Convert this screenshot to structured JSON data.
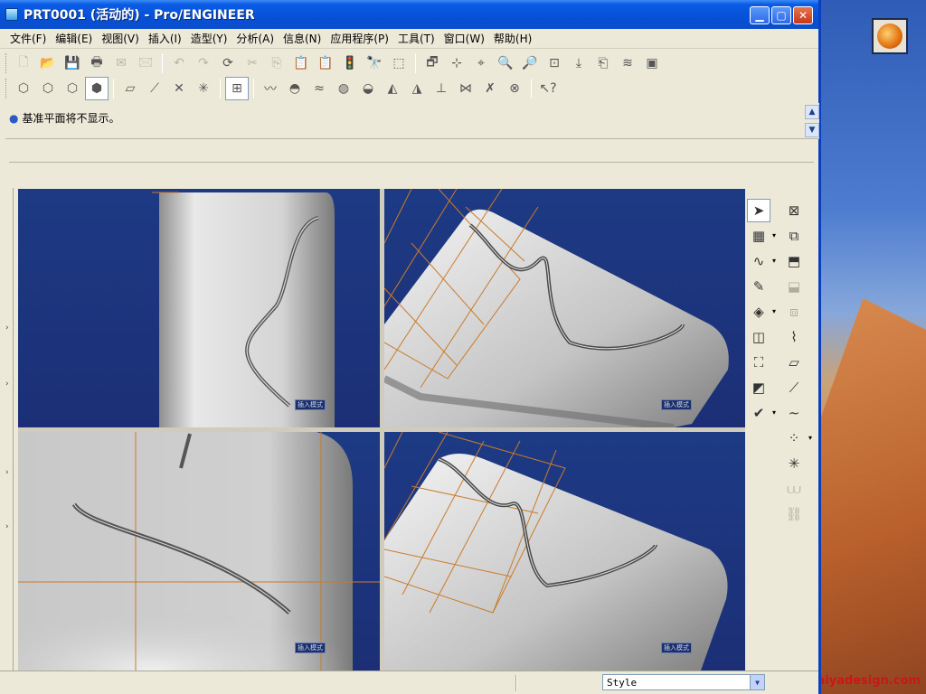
{
  "window": {
    "title": "PRT0001 (活动的) - Pro/ENGINEER",
    "controls": {
      "minimize": "▁",
      "maximize": "▢",
      "close": "✕"
    }
  },
  "menu": [
    "文件(F)",
    "编辑(E)",
    "视图(V)",
    "插入(I)",
    "造型(Y)",
    "分析(A)",
    "信息(N)",
    "应用程序(P)",
    "工具(T)",
    "窗口(W)",
    "帮助(H)"
  ],
  "toolbar1": [
    {
      "name": "new-icon",
      "glyph": "🗋",
      "state": "disabled"
    },
    {
      "name": "open-icon",
      "glyph": "📂",
      "state": "disabled"
    },
    {
      "name": "save-icon",
      "glyph": "💾",
      "state": "disabled"
    },
    {
      "name": "print-icon",
      "glyph": "🖶",
      "state": "enabled"
    },
    {
      "name": "send-mail-icon",
      "glyph": "✉",
      "state": "disabled"
    },
    {
      "name": "send-attach-icon",
      "glyph": "🖂",
      "state": "disabled"
    },
    {
      "sep": true
    },
    {
      "name": "undo-icon",
      "glyph": "↶",
      "state": "disabled"
    },
    {
      "name": "redo-icon",
      "glyph": "↷",
      "state": "disabled"
    },
    {
      "name": "regenerate-icon",
      "glyph": "⟳",
      "state": "enabled"
    },
    {
      "name": "cut-icon",
      "glyph": "✂",
      "state": "disabled"
    },
    {
      "name": "copy-icon",
      "glyph": "⎘",
      "state": "disabled"
    },
    {
      "name": "paste-icon",
      "glyph": "📋",
      "state": "disabled"
    },
    {
      "name": "paste-special-icon",
      "glyph": "📋",
      "state": "disabled"
    },
    {
      "name": "model-player-icon",
      "glyph": "🚦",
      "state": "enabled"
    },
    {
      "name": "find-icon",
      "glyph": "🔭",
      "state": "enabled"
    },
    {
      "name": "select-box-icon",
      "glyph": "⬚",
      "state": "enabled"
    },
    {
      "sep": true
    },
    {
      "name": "repaint-icon",
      "glyph": "🗗",
      "state": "enabled"
    },
    {
      "name": "spin-center-icon",
      "glyph": "⊹",
      "state": "enabled"
    },
    {
      "name": "orient-mode-icon",
      "glyph": "⌖",
      "state": "enabled"
    },
    {
      "name": "zoom-in-icon",
      "glyph": "🔍",
      "state": "enabled"
    },
    {
      "name": "zoom-out-icon",
      "glyph": "🔎",
      "state": "enabled"
    },
    {
      "name": "refit-icon",
      "glyph": "⊡",
      "state": "enabled"
    },
    {
      "name": "reorient-icon",
      "glyph": "⤓",
      "state": "enabled"
    },
    {
      "name": "saved-views-icon",
      "glyph": "⎗",
      "state": "enabled"
    },
    {
      "name": "layers-icon",
      "glyph": "≋",
      "state": "enabled"
    },
    {
      "name": "view-manager-icon",
      "glyph": "▣",
      "state": "enabled"
    }
  ],
  "toolbar2": [
    {
      "name": "wireframe-icon",
      "glyph": "⬡",
      "state": "enabled"
    },
    {
      "name": "hidden-line-icon",
      "glyph": "⬡",
      "state": "enabled"
    },
    {
      "name": "no-hidden-icon",
      "glyph": "⬡",
      "state": "enabled"
    },
    {
      "name": "shading-icon",
      "glyph": "⬢",
      "state": "on"
    },
    {
      "sep": true
    },
    {
      "name": "datum-plane-display-icon",
      "glyph": "▱",
      "state": "enabled"
    },
    {
      "name": "datum-axis-display-icon",
      "glyph": "⟋",
      "state": "enabled"
    },
    {
      "name": "datum-point-display-icon",
      "glyph": "✕",
      "state": "enabled"
    },
    {
      "name": "csys-display-icon",
      "glyph": "✳",
      "state": "enabled"
    },
    {
      "sep": true
    },
    {
      "name": "style-grid-icon",
      "glyph": "⊞",
      "state": "on"
    },
    {
      "sep": true
    },
    {
      "name": "curvature-icon",
      "glyph": "〰",
      "state": "enabled"
    },
    {
      "name": "section-icon",
      "glyph": "◓",
      "state": "enabled"
    },
    {
      "name": "offset-icon",
      "glyph": "≈",
      "state": "enabled"
    },
    {
      "name": "gaussian-icon",
      "glyph": "◍",
      "state": "enabled"
    },
    {
      "name": "slope-icon",
      "glyph": "◒",
      "state": "enabled"
    },
    {
      "name": "reflection-icon",
      "glyph": "◭",
      "state": "enabled"
    },
    {
      "name": "draft-icon",
      "glyph": "◮",
      "state": "enabled"
    },
    {
      "name": "dihedral-icon",
      "glyph": "⊥",
      "state": "enabled"
    },
    {
      "name": "curve-curvature-icon",
      "glyph": "⋈",
      "state": "enabled"
    },
    {
      "name": "delete-analysis-icon",
      "glyph": "✗",
      "state": "enabled"
    },
    {
      "name": "delete-all-icon",
      "glyph": "⊗",
      "state": "enabled"
    },
    {
      "sep": true
    },
    {
      "name": "whats-this-icon",
      "glyph": "↖?",
      "state": "enabled"
    }
  ],
  "message": "基准平面将不显示。",
  "viewport_tag": "插入模式",
  "status": {
    "filter_value": "Style"
  },
  "right_toolbar": [
    {
      "name": "select-arrow-icon",
      "glyph": "➤",
      "col": 0,
      "row": 0,
      "state": "on"
    },
    {
      "name": "set-active-plane-icon",
      "glyph": "▦",
      "col": 0,
      "row": 1,
      "state": "enabled",
      "drop": true
    },
    {
      "name": "create-curve-icon",
      "glyph": "∿",
      "col": 0,
      "row": 2,
      "state": "enabled",
      "drop": true
    },
    {
      "name": "edit-curve-icon",
      "glyph": "✎",
      "col": 0,
      "row": 3,
      "state": "enabled"
    },
    {
      "name": "boundary-surface-icon",
      "glyph": "◈",
      "col": 0,
      "row": 4,
      "state": "enabled",
      "drop": true
    },
    {
      "name": "connect-surface-icon",
      "glyph": "◫",
      "col": 0,
      "row": 5,
      "state": "enabled"
    },
    {
      "name": "trim-surface-icon",
      "glyph": "⛶",
      "col": 0,
      "row": 6,
      "state": "enabled"
    },
    {
      "name": "edit-surface-icon",
      "glyph": "◩",
      "col": 0,
      "row": 7,
      "state": "enabled"
    },
    {
      "name": "done-check-icon",
      "glyph": "✔",
      "col": 0,
      "row": 8,
      "state": "enabled",
      "drop": true
    },
    {
      "name": "cancel-x-icon",
      "glyph": "⊠",
      "col": 1,
      "row": 0,
      "state": "enabled"
    },
    {
      "name": "extrude-icon",
      "glyph": "⧉",
      "col": 1,
      "row": 1,
      "state": "enabled"
    },
    {
      "name": "shell-icon",
      "glyph": "⬒",
      "col": 1,
      "row": 2,
      "state": "enabled"
    },
    {
      "name": "draft-feature-icon",
      "glyph": "⬓",
      "col": 1,
      "row": 3,
      "state": "disabled"
    },
    {
      "name": "pattern-icon",
      "glyph": "⧈",
      "col": 1,
      "row": 4,
      "state": "disabled"
    },
    {
      "name": "sketch-icon",
      "glyph": "⌇",
      "col": 1,
      "row": 5,
      "state": "enabled"
    },
    {
      "name": "datum-plane-icon",
      "glyph": "▱",
      "col": 1,
      "row": 6,
      "state": "enabled"
    },
    {
      "name": "datum-axis-icon",
      "glyph": "⟋",
      "col": 1,
      "row": 7,
      "state": "enabled"
    },
    {
      "name": "datum-curve-icon",
      "glyph": "∼",
      "col": 1,
      "row": 8,
      "state": "enabled"
    },
    {
      "name": "datum-point-icon",
      "glyph": "⁘",
      "col": 1,
      "row": 9,
      "state": "enabled",
      "drop": true
    },
    {
      "name": "csys-icon",
      "glyph": "✳",
      "col": 1,
      "row": 10,
      "state": "enabled"
    },
    {
      "name": "analysis-feature-icon",
      "glyph": "⩊",
      "col": 1,
      "row": 11,
      "state": "disabled"
    },
    {
      "name": "inheritance-icon",
      "glyph": "⛓",
      "col": 1,
      "row": 12,
      "state": "disabled"
    }
  ],
  "desktop": {
    "watermark": "www.maiyadesign.com"
  },
  "colors": {
    "viewport_bg": "#1d3a84",
    "xp_title": "#0a5ce4",
    "datum_grid": "#c97b2a",
    "surface": "#c8c8c8"
  }
}
